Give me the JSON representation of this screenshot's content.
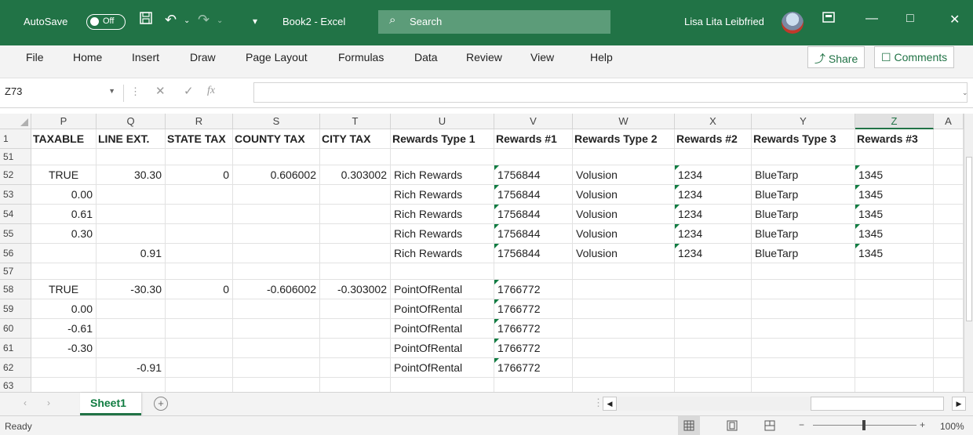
{
  "titlebar": {
    "autosave_label": "AutoSave",
    "autosave_state": "Off",
    "doc_title": "Book2 - Excel",
    "search_label": "Search",
    "user_name": "Lisa Lita Leibfried"
  },
  "ribbon": {
    "tabs": [
      "File",
      "Home",
      "Insert",
      "Draw",
      "Page Layout",
      "Formulas",
      "Data",
      "Review",
      "View",
      "Help"
    ],
    "share_label": "Share",
    "comments_label": "Comments"
  },
  "formula_bar": {
    "name_box": "Z73",
    "fx": "fx",
    "value": ""
  },
  "grid": {
    "columns": [
      "P",
      "Q",
      "R",
      "S",
      "T",
      "U",
      "V",
      "W",
      "X",
      "Y",
      "Z",
      "A"
    ],
    "selected_column": "Z",
    "rows": [
      {
        "num": "1",
        "cells": [
          {
            "v": "TAXABLE",
            "a": "l",
            "b": true
          },
          {
            "v": "LINE EXT.",
            "a": "l",
            "b": true
          },
          {
            "v": "STATE TAX",
            "a": "l",
            "b": true
          },
          {
            "v": "COUNTY TAX",
            "a": "l",
            "b": true
          },
          {
            "v": "CITY TAX",
            "a": "l",
            "b": true
          },
          {
            "v": "Rewards Type 1",
            "a": "l",
            "b": true
          },
          {
            "v": "Rewards #1",
            "a": "l",
            "b": true
          },
          {
            "v": "Rewards Type 2",
            "a": "l",
            "b": true
          },
          {
            "v": "Rewards #2",
            "a": "l",
            "b": true
          },
          {
            "v": "Rewards Type 3",
            "a": "l",
            "b": true
          },
          {
            "v": "Rewards #3",
            "a": "l",
            "b": true
          },
          {
            "v": "",
            "a": "l"
          }
        ]
      },
      {
        "num": "51",
        "short": true,
        "cells": [
          {
            "v": ""
          },
          {
            "v": ""
          },
          {
            "v": ""
          },
          {
            "v": ""
          },
          {
            "v": ""
          },
          {
            "v": ""
          },
          {
            "v": ""
          },
          {
            "v": ""
          },
          {
            "v": ""
          },
          {
            "v": ""
          },
          {
            "v": ""
          },
          {
            "v": ""
          }
        ]
      },
      {
        "num": "52",
        "cells": [
          {
            "v": "TRUE",
            "a": "c"
          },
          {
            "v": "30.30",
            "a": "r"
          },
          {
            "v": "0",
            "a": "r"
          },
          {
            "v": "0.606002",
            "a": "r"
          },
          {
            "v": "0.303002",
            "a": "r"
          },
          {
            "v": "Rich Rewards",
            "a": "l"
          },
          {
            "v": "1756844",
            "a": "l",
            "t": true
          },
          {
            "v": "Volusion",
            "a": "l"
          },
          {
            "v": "1234",
            "a": "l",
            "t": true
          },
          {
            "v": "BlueTarp",
            "a": "l"
          },
          {
            "v": "1345",
            "a": "l",
            "t": true
          },
          {
            "v": ""
          }
        ]
      },
      {
        "num": "53",
        "cells": [
          {
            "v": "0.00",
            "a": "r"
          },
          {
            "v": ""
          },
          {
            "v": ""
          },
          {
            "v": ""
          },
          {
            "v": ""
          },
          {
            "v": "Rich Rewards",
            "a": "l"
          },
          {
            "v": "1756844",
            "a": "l",
            "t": true
          },
          {
            "v": "Volusion",
            "a": "l"
          },
          {
            "v": "1234",
            "a": "l",
            "t": true
          },
          {
            "v": "BlueTarp",
            "a": "l"
          },
          {
            "v": "1345",
            "a": "l",
            "t": true
          },
          {
            "v": ""
          }
        ]
      },
      {
        "num": "54",
        "cells": [
          {
            "v": "0.61",
            "a": "r"
          },
          {
            "v": ""
          },
          {
            "v": ""
          },
          {
            "v": ""
          },
          {
            "v": ""
          },
          {
            "v": "Rich Rewards",
            "a": "l"
          },
          {
            "v": "1756844",
            "a": "l",
            "t": true
          },
          {
            "v": "Volusion",
            "a": "l"
          },
          {
            "v": "1234",
            "a": "l",
            "t": true
          },
          {
            "v": "BlueTarp",
            "a": "l"
          },
          {
            "v": "1345",
            "a": "l",
            "t": true
          },
          {
            "v": ""
          }
        ]
      },
      {
        "num": "55",
        "cells": [
          {
            "v": "0.30",
            "a": "r"
          },
          {
            "v": ""
          },
          {
            "v": ""
          },
          {
            "v": ""
          },
          {
            "v": ""
          },
          {
            "v": "Rich Rewards",
            "a": "l"
          },
          {
            "v": "1756844",
            "a": "l",
            "t": true
          },
          {
            "v": "Volusion",
            "a": "l"
          },
          {
            "v": "1234",
            "a": "l",
            "t": true
          },
          {
            "v": "BlueTarp",
            "a": "l"
          },
          {
            "v": "1345",
            "a": "l",
            "t": true
          },
          {
            "v": ""
          }
        ]
      },
      {
        "num": "56",
        "cells": [
          {
            "v": ""
          },
          {
            "v": "0.91",
            "a": "r"
          },
          {
            "v": ""
          },
          {
            "v": ""
          },
          {
            "v": ""
          },
          {
            "v": "Rich Rewards",
            "a": "l"
          },
          {
            "v": "1756844",
            "a": "l",
            "t": true
          },
          {
            "v": "Volusion",
            "a": "l"
          },
          {
            "v": "1234",
            "a": "l",
            "t": true
          },
          {
            "v": "BlueTarp",
            "a": "l"
          },
          {
            "v": "1345",
            "a": "l",
            "t": true
          },
          {
            "v": ""
          }
        ]
      },
      {
        "num": "57",
        "short": true,
        "cells": [
          {
            "v": ""
          },
          {
            "v": ""
          },
          {
            "v": ""
          },
          {
            "v": ""
          },
          {
            "v": ""
          },
          {
            "v": ""
          },
          {
            "v": ""
          },
          {
            "v": ""
          },
          {
            "v": ""
          },
          {
            "v": ""
          },
          {
            "v": ""
          },
          {
            "v": ""
          }
        ]
      },
      {
        "num": "58",
        "cells": [
          {
            "v": "TRUE",
            "a": "c"
          },
          {
            "v": "-30.30",
            "a": "r"
          },
          {
            "v": "0",
            "a": "r"
          },
          {
            "v": "-0.606002",
            "a": "r"
          },
          {
            "v": "-0.303002",
            "a": "r"
          },
          {
            "v": "PointOfRental",
            "a": "l"
          },
          {
            "v": "1766772",
            "a": "l",
            "t": true
          },
          {
            "v": ""
          },
          {
            "v": ""
          },
          {
            "v": ""
          },
          {
            "v": ""
          },
          {
            "v": ""
          }
        ]
      },
      {
        "num": "59",
        "cells": [
          {
            "v": "0.00",
            "a": "r"
          },
          {
            "v": ""
          },
          {
            "v": ""
          },
          {
            "v": ""
          },
          {
            "v": ""
          },
          {
            "v": "PointOfRental",
            "a": "l"
          },
          {
            "v": "1766772",
            "a": "l",
            "t": true
          },
          {
            "v": ""
          },
          {
            "v": ""
          },
          {
            "v": ""
          },
          {
            "v": ""
          },
          {
            "v": ""
          }
        ]
      },
      {
        "num": "60",
        "cells": [
          {
            "v": "-0.61",
            "a": "r"
          },
          {
            "v": ""
          },
          {
            "v": ""
          },
          {
            "v": ""
          },
          {
            "v": ""
          },
          {
            "v": "PointOfRental",
            "a": "l"
          },
          {
            "v": "1766772",
            "a": "l",
            "t": true
          },
          {
            "v": ""
          },
          {
            "v": ""
          },
          {
            "v": ""
          },
          {
            "v": ""
          },
          {
            "v": ""
          }
        ]
      },
      {
        "num": "61",
        "cells": [
          {
            "v": "-0.30",
            "a": "r"
          },
          {
            "v": ""
          },
          {
            "v": ""
          },
          {
            "v": ""
          },
          {
            "v": ""
          },
          {
            "v": "PointOfRental",
            "a": "l"
          },
          {
            "v": "1766772",
            "a": "l",
            "t": true
          },
          {
            "v": ""
          },
          {
            "v": ""
          },
          {
            "v": ""
          },
          {
            "v": ""
          },
          {
            "v": ""
          }
        ]
      },
      {
        "num": "62",
        "cells": [
          {
            "v": ""
          },
          {
            "v": "-0.91",
            "a": "r"
          },
          {
            "v": ""
          },
          {
            "v": ""
          },
          {
            "v": ""
          },
          {
            "v": "PointOfRental",
            "a": "l"
          },
          {
            "v": "1766772",
            "a": "l",
            "t": true
          },
          {
            "v": ""
          },
          {
            "v": ""
          },
          {
            "v": ""
          },
          {
            "v": ""
          },
          {
            "v": ""
          }
        ]
      },
      {
        "num": "63",
        "short": true,
        "cells": [
          {
            "v": ""
          },
          {
            "v": ""
          },
          {
            "v": ""
          },
          {
            "v": ""
          },
          {
            "v": ""
          },
          {
            "v": ""
          },
          {
            "v": ""
          },
          {
            "v": ""
          },
          {
            "v": ""
          },
          {
            "v": ""
          },
          {
            "v": ""
          },
          {
            "v": ""
          }
        ]
      }
    ]
  },
  "sheets": {
    "tabs": [
      "Sheet1"
    ],
    "active": "Sheet1",
    "add_label": "+"
  },
  "status": {
    "text": "Ready",
    "zoom": "100%"
  },
  "colors": {
    "excel_green": "#217346",
    "active_tab_text": "#107c41",
    "ribbon_bg": "#f3f3f3"
  },
  "icons": [
    "save-icon",
    "undo-icon",
    "redo-icon",
    "customize-icon",
    "search-icon",
    "ribbon-display-icon",
    "minimize-icon",
    "maximize-icon",
    "close-icon",
    "share-icon",
    "comments-icon",
    "cancel-icon",
    "enter-icon",
    "function-icon",
    "normal-view-icon",
    "page-layout-view-icon",
    "page-break-view-icon"
  ]
}
